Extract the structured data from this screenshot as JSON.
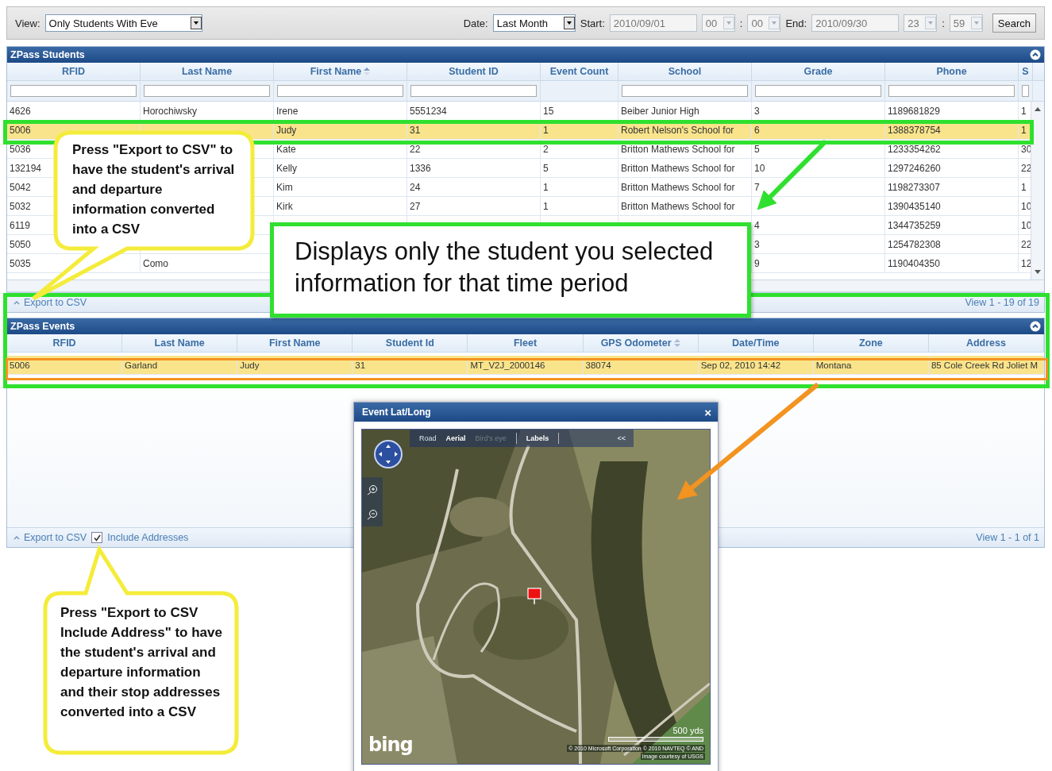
{
  "toolbar": {
    "view": {
      "label": "View:",
      "value": "Only Students With Eve"
    },
    "date": {
      "label": "Date:",
      "value": "Last Month"
    },
    "start": {
      "label": "Start:",
      "date": "2010/09/01",
      "hour": "00",
      "separator": ":",
      "minute": "00",
      "disabled": true
    },
    "end": {
      "label": "End:",
      "date": "2010/09/30",
      "hour": "23",
      "separator": ":",
      "minute": "59",
      "disabled": true
    },
    "search_button": "Search"
  },
  "students_grid": {
    "title": "ZPass Students",
    "columns": [
      {
        "label": "RFID",
        "filter": true
      },
      {
        "label": "Last Name",
        "filter": true
      },
      {
        "label": "First Name",
        "kind": "sorted",
        "filter": true
      },
      {
        "label": "Student ID",
        "filter": true
      },
      {
        "label": "Event Count",
        "filter": false
      },
      {
        "label": "School",
        "filter": true
      },
      {
        "label": "Grade",
        "filter": true
      },
      {
        "label": "Phone",
        "filter": true
      },
      {
        "label": "S",
        "filter": true
      }
    ],
    "rows": [
      {
        "selected": false,
        "cells": [
          "4626",
          "Horochiwsky",
          "Irene",
          "5551234",
          "15",
          "Beiber Junior High",
          "3",
          "1189681829",
          "1"
        ]
      },
      {
        "selected": true,
        "cells": [
          "5006",
          null,
          "Judy",
          "31",
          "1",
          "Robert Nelson's School for",
          "6",
          "1388378754",
          "1"
        ]
      },
      {
        "selected": false,
        "cells": [
          "5036",
          null,
          "Kate",
          "22",
          "2",
          "Britton Mathews School for",
          "5",
          "1233354262",
          "30"
        ]
      },
      {
        "selected": false,
        "cells": [
          "132194",
          null,
          "Kelly",
          "1336",
          "5",
          "Britton Mathews School for",
          "10",
          "1297246260",
          "22"
        ]
      },
      {
        "selected": false,
        "cells": [
          "5042",
          null,
          "Kim",
          "24",
          "1",
          "Britton Mathews School for",
          "7",
          "1198273307",
          "1"
        ]
      },
      {
        "selected": false,
        "cells": [
          "5032",
          null,
          "Kirk",
          "27",
          "1",
          "Britton Mathews School for",
          null,
          "1390435140",
          "10"
        ]
      },
      {
        "selected": false,
        "cells": [
          "6119",
          null,
          null,
          null,
          null,
          null,
          "4",
          "1344735259",
          "10"
        ]
      },
      {
        "selected": false,
        "cells": [
          "5050",
          null,
          null,
          null,
          null,
          null,
          "3",
          "1254782308",
          "22"
        ]
      },
      {
        "selected": false,
        "cells": [
          "5035",
          "Como",
          null,
          null,
          null,
          null,
          "9",
          "1190404350",
          "12"
        ]
      }
    ],
    "footer": {
      "export": "Export to CSV",
      "pager": "View 1 - 19 of 19"
    }
  },
  "events_grid": {
    "title": "ZPass Events",
    "columns": [
      {
        "label": "RFID"
      },
      {
        "label": "Last Name"
      },
      {
        "label": "First Name"
      },
      {
        "label": "Student Id"
      },
      {
        "label": "Fleet"
      },
      {
        "label": "GPS Odometer",
        "kind": "sortable"
      },
      {
        "label": "Date/Time"
      },
      {
        "label": "Zone"
      },
      {
        "label": "Address"
      }
    ],
    "rows": [
      {
        "selected": true,
        "cells": [
          "5006",
          "Garland",
          "Judy",
          "31",
          "MT_V2J_2000146",
          "38074",
          "Sep 02, 2010 14:42",
          "Montana",
          "85 Cole Creek Rd Joliet M"
        ]
      }
    ],
    "footer": {
      "export": "Export to CSV",
      "include_addresses": {
        "label": "Include Addresses",
        "checked": true
      },
      "pager": "View 1 - 1 of 1"
    }
  },
  "map_window": {
    "title": "Event Lat/Long",
    "close": "×",
    "modes": [
      {
        "label": "Road",
        "selected": false,
        "disabled": false
      },
      {
        "label": "Aerial",
        "selected": true,
        "disabled": false
      },
      {
        "label": "Bird's eye",
        "selected": false,
        "disabled": true
      }
    ],
    "labels_toggle": {
      "label": "Labels",
      "on": true
    },
    "collapse": "<<",
    "scale": "500 yds",
    "logo": "bing",
    "copyright": "© 2010 Microsoft Corporation   © 2010 NAVTEQ   © AND",
    "credit": "Image courtesy of USGS"
  },
  "callouts": [
    {
      "kind": "bubble",
      "text": "Press \"Export to CSV\" to have the student's arrival and departure information converted into a CSV"
    },
    {
      "kind": "box",
      "text": "Displays only the student you selected information for that time period"
    },
    {
      "kind": "bubble",
      "text": "Press \"Export to CSV Include Address\" to have the student's arrival and departure information and their stop addresses converted into a CSV"
    }
  ]
}
